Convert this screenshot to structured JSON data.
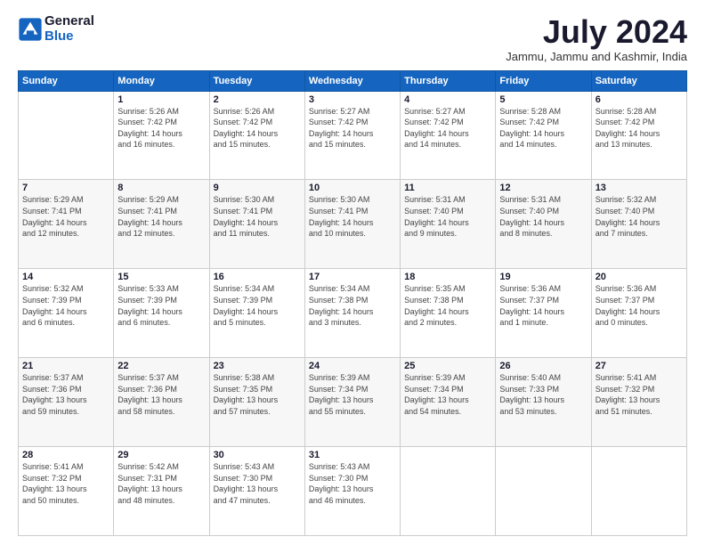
{
  "logo": {
    "line1": "General",
    "line2": "Blue"
  },
  "title": {
    "month_year": "July 2024",
    "location": "Jammu, Jammu and Kashmir, India"
  },
  "weekdays": [
    "Sunday",
    "Monday",
    "Tuesday",
    "Wednesday",
    "Thursday",
    "Friday",
    "Saturday"
  ],
  "weeks": [
    [
      {
        "day": "",
        "info": ""
      },
      {
        "day": "1",
        "info": "Sunrise: 5:26 AM\nSunset: 7:42 PM\nDaylight: 14 hours\nand 16 minutes."
      },
      {
        "day": "2",
        "info": "Sunrise: 5:26 AM\nSunset: 7:42 PM\nDaylight: 14 hours\nand 15 minutes."
      },
      {
        "day": "3",
        "info": "Sunrise: 5:27 AM\nSunset: 7:42 PM\nDaylight: 14 hours\nand 15 minutes."
      },
      {
        "day": "4",
        "info": "Sunrise: 5:27 AM\nSunset: 7:42 PM\nDaylight: 14 hours\nand 14 minutes."
      },
      {
        "day": "5",
        "info": "Sunrise: 5:28 AM\nSunset: 7:42 PM\nDaylight: 14 hours\nand 14 minutes."
      },
      {
        "day": "6",
        "info": "Sunrise: 5:28 AM\nSunset: 7:42 PM\nDaylight: 14 hours\nand 13 minutes."
      }
    ],
    [
      {
        "day": "7",
        "info": "Sunrise: 5:29 AM\nSunset: 7:41 PM\nDaylight: 14 hours\nand 12 minutes."
      },
      {
        "day": "8",
        "info": "Sunrise: 5:29 AM\nSunset: 7:41 PM\nDaylight: 14 hours\nand 12 minutes."
      },
      {
        "day": "9",
        "info": "Sunrise: 5:30 AM\nSunset: 7:41 PM\nDaylight: 14 hours\nand 11 minutes."
      },
      {
        "day": "10",
        "info": "Sunrise: 5:30 AM\nSunset: 7:41 PM\nDaylight: 14 hours\nand 10 minutes."
      },
      {
        "day": "11",
        "info": "Sunrise: 5:31 AM\nSunset: 7:40 PM\nDaylight: 14 hours\nand 9 minutes."
      },
      {
        "day": "12",
        "info": "Sunrise: 5:31 AM\nSunset: 7:40 PM\nDaylight: 14 hours\nand 8 minutes."
      },
      {
        "day": "13",
        "info": "Sunrise: 5:32 AM\nSunset: 7:40 PM\nDaylight: 14 hours\nand 7 minutes."
      }
    ],
    [
      {
        "day": "14",
        "info": "Sunrise: 5:32 AM\nSunset: 7:39 PM\nDaylight: 14 hours\nand 6 minutes."
      },
      {
        "day": "15",
        "info": "Sunrise: 5:33 AM\nSunset: 7:39 PM\nDaylight: 14 hours\nand 6 minutes."
      },
      {
        "day": "16",
        "info": "Sunrise: 5:34 AM\nSunset: 7:39 PM\nDaylight: 14 hours\nand 5 minutes."
      },
      {
        "day": "17",
        "info": "Sunrise: 5:34 AM\nSunset: 7:38 PM\nDaylight: 14 hours\nand 3 minutes."
      },
      {
        "day": "18",
        "info": "Sunrise: 5:35 AM\nSunset: 7:38 PM\nDaylight: 14 hours\nand 2 minutes."
      },
      {
        "day": "19",
        "info": "Sunrise: 5:36 AM\nSunset: 7:37 PM\nDaylight: 14 hours\nand 1 minute."
      },
      {
        "day": "20",
        "info": "Sunrise: 5:36 AM\nSunset: 7:37 PM\nDaylight: 14 hours\nand 0 minutes."
      }
    ],
    [
      {
        "day": "21",
        "info": "Sunrise: 5:37 AM\nSunset: 7:36 PM\nDaylight: 13 hours\nand 59 minutes."
      },
      {
        "day": "22",
        "info": "Sunrise: 5:37 AM\nSunset: 7:36 PM\nDaylight: 13 hours\nand 58 minutes."
      },
      {
        "day": "23",
        "info": "Sunrise: 5:38 AM\nSunset: 7:35 PM\nDaylight: 13 hours\nand 57 minutes."
      },
      {
        "day": "24",
        "info": "Sunrise: 5:39 AM\nSunset: 7:34 PM\nDaylight: 13 hours\nand 55 minutes."
      },
      {
        "day": "25",
        "info": "Sunrise: 5:39 AM\nSunset: 7:34 PM\nDaylight: 13 hours\nand 54 minutes."
      },
      {
        "day": "26",
        "info": "Sunrise: 5:40 AM\nSunset: 7:33 PM\nDaylight: 13 hours\nand 53 minutes."
      },
      {
        "day": "27",
        "info": "Sunrise: 5:41 AM\nSunset: 7:32 PM\nDaylight: 13 hours\nand 51 minutes."
      }
    ],
    [
      {
        "day": "28",
        "info": "Sunrise: 5:41 AM\nSunset: 7:32 PM\nDaylight: 13 hours\nand 50 minutes."
      },
      {
        "day": "29",
        "info": "Sunrise: 5:42 AM\nSunset: 7:31 PM\nDaylight: 13 hours\nand 48 minutes."
      },
      {
        "day": "30",
        "info": "Sunrise: 5:43 AM\nSunset: 7:30 PM\nDaylight: 13 hours\nand 47 minutes."
      },
      {
        "day": "31",
        "info": "Sunrise: 5:43 AM\nSunset: 7:30 PM\nDaylight: 13 hours\nand 46 minutes."
      },
      {
        "day": "",
        "info": ""
      },
      {
        "day": "",
        "info": ""
      },
      {
        "day": "",
        "info": ""
      }
    ]
  ]
}
